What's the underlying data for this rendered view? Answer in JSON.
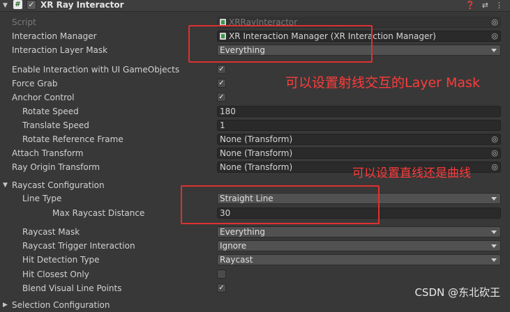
{
  "header": {
    "title": "XR Ray Interactor",
    "enabled": true,
    "icons": [
      "help-icon",
      "presets-icon",
      "more-icon"
    ]
  },
  "rows": {
    "script": {
      "label": "Script",
      "value": "XRRayInteractor"
    },
    "interaction_manager": {
      "label": "Interaction Manager",
      "value": "XR Interaction Manager (XR Interaction Manager)"
    },
    "interaction_layer_mask": {
      "label": "Interaction Layer Mask",
      "value": "Everything"
    },
    "enable_ui": {
      "label": "Enable Interaction with UI GameObjects",
      "checked": true
    },
    "force_grab": {
      "label": "Force Grab",
      "checked": true
    },
    "anchor_control": {
      "label": "Anchor Control",
      "checked": true
    },
    "rotate_speed": {
      "label": "Rotate Speed",
      "value": "180"
    },
    "translate_speed": {
      "label": "Translate Speed",
      "value": "1"
    },
    "rotate_reference_frame": {
      "label": "Rotate Reference Frame",
      "value": "None (Transform)"
    },
    "attach_transform": {
      "label": "Attach Transform",
      "value": "None (Transform)"
    },
    "ray_origin_transform": {
      "label": "Ray Origin Transform",
      "value": "None (Transform)"
    },
    "raycast_configuration": {
      "label": "Raycast Configuration"
    },
    "line_type": {
      "label": "Line Type",
      "value": "Straight Line"
    },
    "max_raycast_distance": {
      "label": "Max Raycast Distance",
      "value": "30"
    },
    "raycast_mask": {
      "label": "Raycast Mask",
      "value": "Everything"
    },
    "raycast_trigger_interaction": {
      "label": "Raycast Trigger Interaction",
      "value": "Ignore"
    },
    "hit_detection_type": {
      "label": "Hit Detection Type",
      "value": "Raycast"
    },
    "hit_closest_only": {
      "label": "Hit Closest Only",
      "checked": false
    },
    "blend_visual_line_points": {
      "label": "Blend Visual Line Points",
      "checked": true
    },
    "selection_configuration": {
      "label": "Selection Configuration"
    }
  },
  "annotations": {
    "layer_mask_note": "可以设置射线交互的Layer Mask",
    "line_type_note": "可以设置直线还是曲线"
  },
  "watermark": "CSDN @东北砍王",
  "colors": {
    "annotation": "#e03030",
    "background": "#383838",
    "field": "#2a2a2a"
  }
}
